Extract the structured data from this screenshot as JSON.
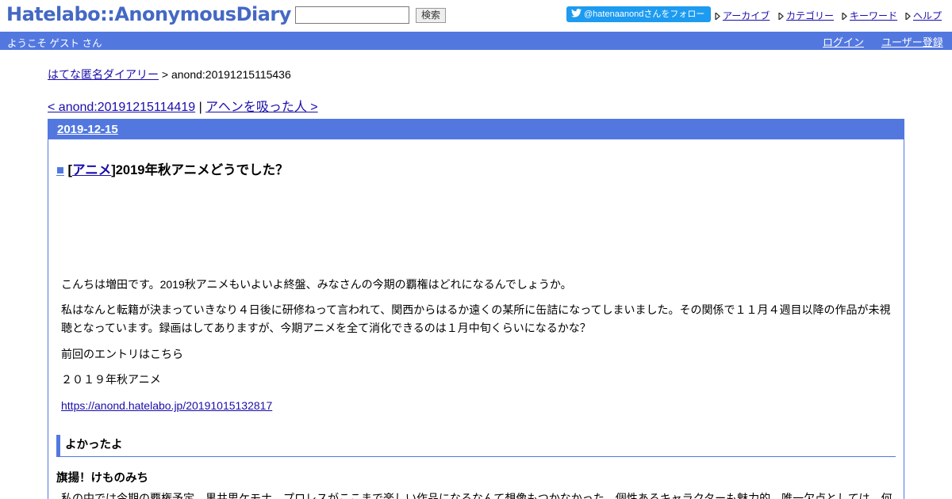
{
  "header": {
    "logo": "Hatelabo::AnonymousDiary",
    "search_value": "",
    "search_button": "検索",
    "follow_button": "@hatenaanondさんをフォロー",
    "links": [
      {
        "label": "アーカイブ"
      },
      {
        "label": "カテゴリー"
      },
      {
        "label": "キーワード"
      },
      {
        "label": "ヘルプ"
      }
    ]
  },
  "bar": {
    "welcome": "ようこそ ゲスト さん",
    "login": "ログイン",
    "register": "ユーザー登録"
  },
  "breadcrumb": {
    "home": "はてな匿名ダイアリー",
    "separator": " > ",
    "current": "anond:20191215115436"
  },
  "nav": {
    "prev": "< anond:20191215114419",
    "divider": " | ",
    "next": "アヘンを吸った人 >"
  },
  "day": {
    "date": "2019-12-15"
  },
  "entry": {
    "square": "■",
    "bracket_open": " [",
    "category": "アニメ",
    "bracket_close": "]",
    "title": "2019年秋アニメどうでした？",
    "p1": "こんちは増田です。2019秋アニメもいよいよ終盤、みなさんの今期の覇権はどれになるんでしょうか。",
    "p2": "私はなんと転籍が決まっていきなり４日後に研修ねって言われて、関西からはるか遠くの某所に缶詰になってしまいました。その関係で１１月４週目以降の作品が未視聴となっています。録画はしてありますが、今期アニメを全て消化できるのは１月中旬くらいになるかな？",
    "p3": "前回のエントリはこちら",
    "p4": "２０１９年秋アニメ",
    "link": "https://anond.hatelabo.jp/20191015132817",
    "section": "よかったよ",
    "sub": "旗揚！けものみち",
    "p5": "私の中では今期の覇権予定。黒井思ケモナ　プロレスがここまで楽しい作品になるなんて想像もつかなかった。個性あるキャラクターも魅力的。唯一欠点としては、何"
  },
  "colors": {
    "accent": "#5278e0",
    "logo": "#4468c4",
    "link": "#1a0dab",
    "twitter": "#1d9bf0"
  }
}
